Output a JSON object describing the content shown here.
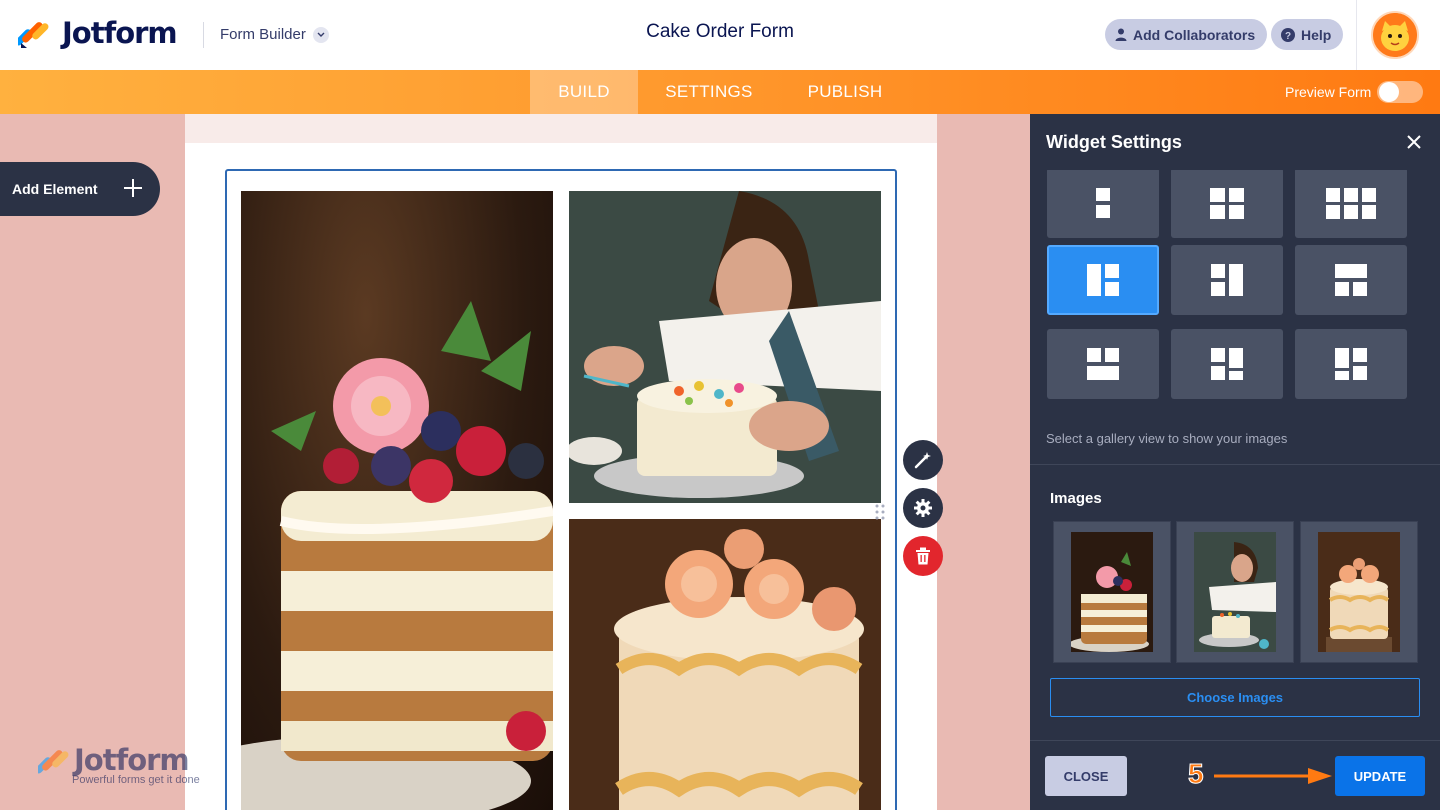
{
  "header": {
    "brand": "Jotform",
    "builder_label": "Form Builder",
    "form_title": "Cake Order Form",
    "collab_label": "Add Collaborators",
    "help_label": "Help"
  },
  "nav": {
    "tabs": [
      {
        "label": "BUILD",
        "active": true
      },
      {
        "label": "SETTINGS",
        "active": false
      },
      {
        "label": "PUBLISH",
        "active": false
      }
    ],
    "preview_label": "Preview Form",
    "preview_on": false
  },
  "canvas": {
    "add_element_label": "Add Element",
    "watermark_brand": "Jotform",
    "watermark_tagline": "Powerful forms get it done"
  },
  "panel": {
    "title": "Widget Settings",
    "layouts_hint": "Select a gallery view to show your images",
    "selected_layout": 4,
    "images_label": "Images",
    "choose_images_label": "Choose Images",
    "close_label": "CLOSE",
    "update_label": "UPDATE"
  },
  "annotation": {
    "step": "5"
  },
  "colors": {
    "brand_navy": "#0a1551",
    "nav_orange": "#ff7a12",
    "panel_bg": "#2b3245",
    "accent_blue": "#0a73e8",
    "delete_red": "#e2262d"
  }
}
